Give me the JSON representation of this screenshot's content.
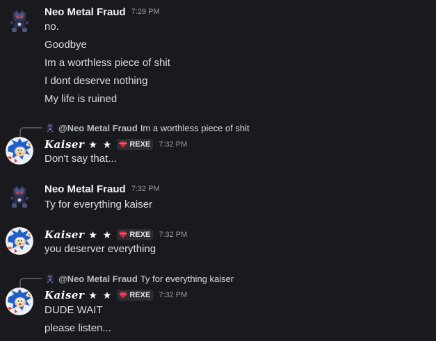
{
  "messages": [
    {
      "author": "Neo Metal Fraud",
      "time": "7:29 PM",
      "lines": [
        "no.",
        "Goodbye",
        "Im a worthless piece of shit",
        "I dont deserve nothing",
        "My life is ruined"
      ]
    },
    {
      "reply": {
        "mention": "@Neo Metal Fraud",
        "text": "Im a worthless piece of shit"
      },
      "author": "𝑲𝒂𝒊𝒔𝒆𝒓",
      "stars": "★ ★",
      "tag": "REXE",
      "time": "7:32 PM",
      "lines": [
        "Don't say that..."
      ]
    },
    {
      "author": "Neo Metal Fraud",
      "time": "7:32 PM",
      "lines": [
        "Ty for everything kaiser"
      ]
    },
    {
      "author": "𝑲𝒂𝒊𝒔𝒆𝒓",
      "stars": "★ ★",
      "tag": "REXE",
      "time": "7:32 PM",
      "lines": [
        "you deserver everything"
      ]
    },
    {
      "reply": {
        "mention": "@Neo Metal Fraud",
        "text": "Ty for everything kaiser"
      },
      "author": "𝑲𝒂𝒊𝒔𝒆𝒓",
      "stars": "★ ★",
      "tag": "REXE",
      "time": "7:32 PM",
      "lines": [
        "DUDE WAIT",
        "please listen..."
      ]
    }
  ],
  "colors": {
    "background": "#1a1a1e",
    "username": "#f2f3f5",
    "message_text": "#dbdee1",
    "timestamp": "#949ba4",
    "tag_background": "#2b2d31",
    "gem": "#e0334b"
  },
  "icons": {
    "neo_avatar": "metal-robot-avatar-icon",
    "kaiser_avatar": "blue-hedgehog-avatar-icon",
    "tag_icon": "red-gem-icon"
  }
}
